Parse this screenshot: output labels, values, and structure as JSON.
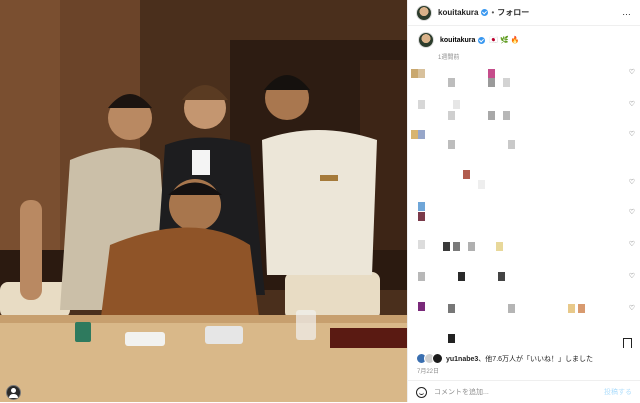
{
  "post": {
    "username": "kouitakura",
    "follow_label": "フォロー",
    "separator": "•",
    "more_label": "…",
    "caption_emoji": "🇯🇵 🌿 🔥",
    "time_ago": "1週間前"
  },
  "likes": {
    "first_user": "yu1nabe3",
    "suffix": "、他7.6万人が「いいね！」しました"
  },
  "date": "7月22日",
  "composer": {
    "placeholder": "コメントを追加...",
    "post_label": "投稿する"
  },
  "icons": {
    "heart": "heart-icon",
    "bookmark": "bookmark-icon",
    "smiley": "emoji-icon",
    "verified": "verified-badge-icon",
    "user": "user-icon"
  },
  "colors": {
    "verified": "#3897f0",
    "muted": "#8e8e8e",
    "post_button": "#b2dffc"
  }
}
